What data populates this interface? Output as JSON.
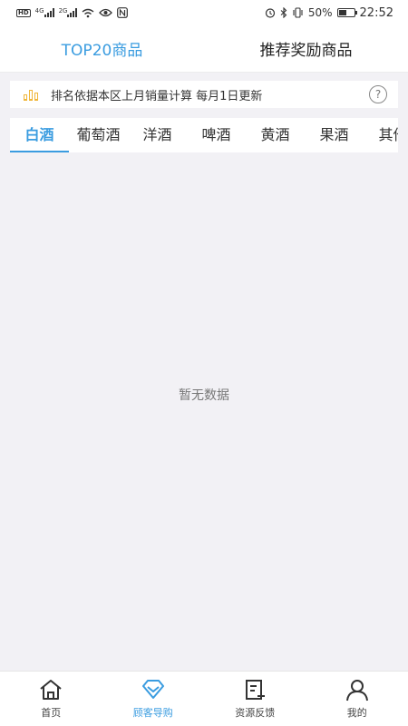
{
  "status_bar": {
    "hd": "HD",
    "net1": "4G",
    "net2": "2G",
    "battery_pct": "50%",
    "time": "22:52"
  },
  "header": {
    "tabs": [
      {
        "label": "TOP20商品",
        "active": true
      },
      {
        "label": "推荐奖励商品",
        "active": false
      }
    ]
  },
  "notice": {
    "text": "排名依据本区上月销量计算 每月1日更新",
    "help": "?"
  },
  "categories": [
    {
      "label": "白酒"
    },
    {
      "label": "葡萄酒"
    },
    {
      "label": "洋酒"
    },
    {
      "label": "啤酒"
    },
    {
      "label": "黄酒"
    },
    {
      "label": "果酒"
    },
    {
      "label": "其他"
    }
  ],
  "empty_text": "暂无数据",
  "bottom_nav": [
    {
      "label": "首页",
      "icon": "home-icon"
    },
    {
      "label": "顾客导购",
      "icon": "diamond-icon"
    },
    {
      "label": "资源反馈",
      "icon": "feedback-icon"
    },
    {
      "label": "我的",
      "icon": "user-icon"
    }
  ],
  "colors": {
    "accent": "#3a9ce0",
    "notice_icon": "#f0b63a",
    "background": "#f2f1f5"
  }
}
